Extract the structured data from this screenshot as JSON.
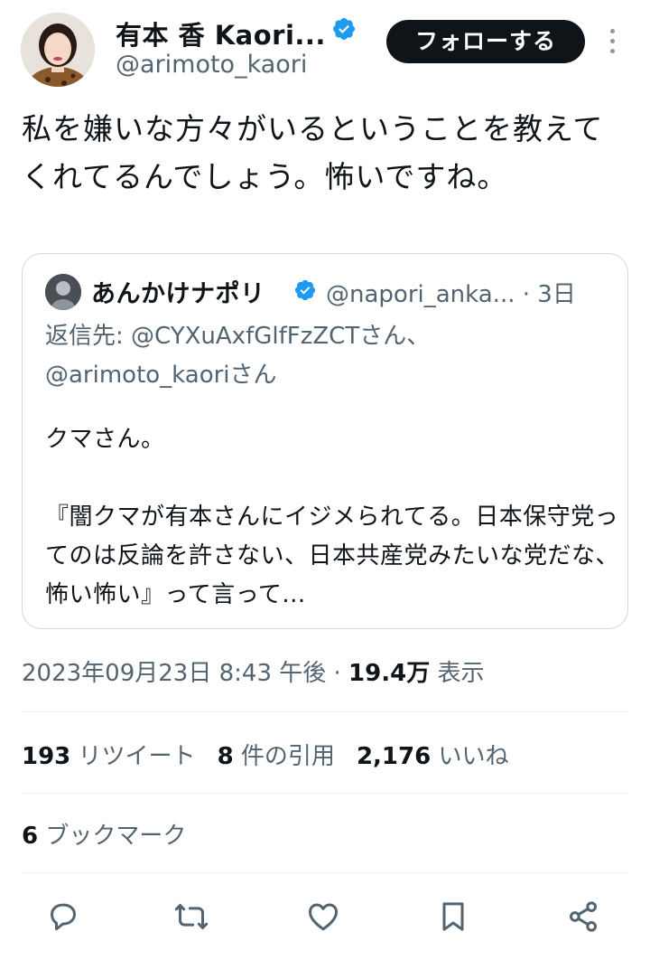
{
  "author": {
    "display_name": "有本 香 Kaori...",
    "handle": "@arimoto_kaori",
    "follow_label": "フォローする"
  },
  "tweet": {
    "text": "私を嫌いな方々がいるということを教えてくれてるんでしょう。怖いですね。"
  },
  "quoted": {
    "display_name": "あんかけナポリ",
    "handle": "@napori_anka...",
    "time": "· 3日",
    "reply_to": "返信先: @CYXuAxfGlfFzZCTさん、@arimoto_kaoriさん",
    "line1": "クマさん。",
    "line2": "『闇クマが有本さんにイジメられてる。日本保守党ってのは反論を許さない、日本共産党みたいな党だな、怖い怖い』って言って..."
  },
  "meta": {
    "datetime": "2023年09月23日 8:43 午後 · ",
    "views_count": "19.4万",
    "views_label": " 表示"
  },
  "stats": {
    "retweets_count": "193",
    "retweets_label": "リツイート",
    "quotes_count": "8",
    "quotes_label": "件の引用",
    "likes_count": "2,176",
    "likes_label": "いいね",
    "bookmarks_count": "6",
    "bookmarks_label": "ブックマーク"
  },
  "actions": [
    "reply-icon",
    "retweet-icon",
    "like-icon",
    "bookmark-icon",
    "share-icon"
  ],
  "colors": {
    "text_primary": "#0f1419",
    "text_secondary": "#536471",
    "verified": "#1d9bf0",
    "border": "#cfd9de"
  }
}
